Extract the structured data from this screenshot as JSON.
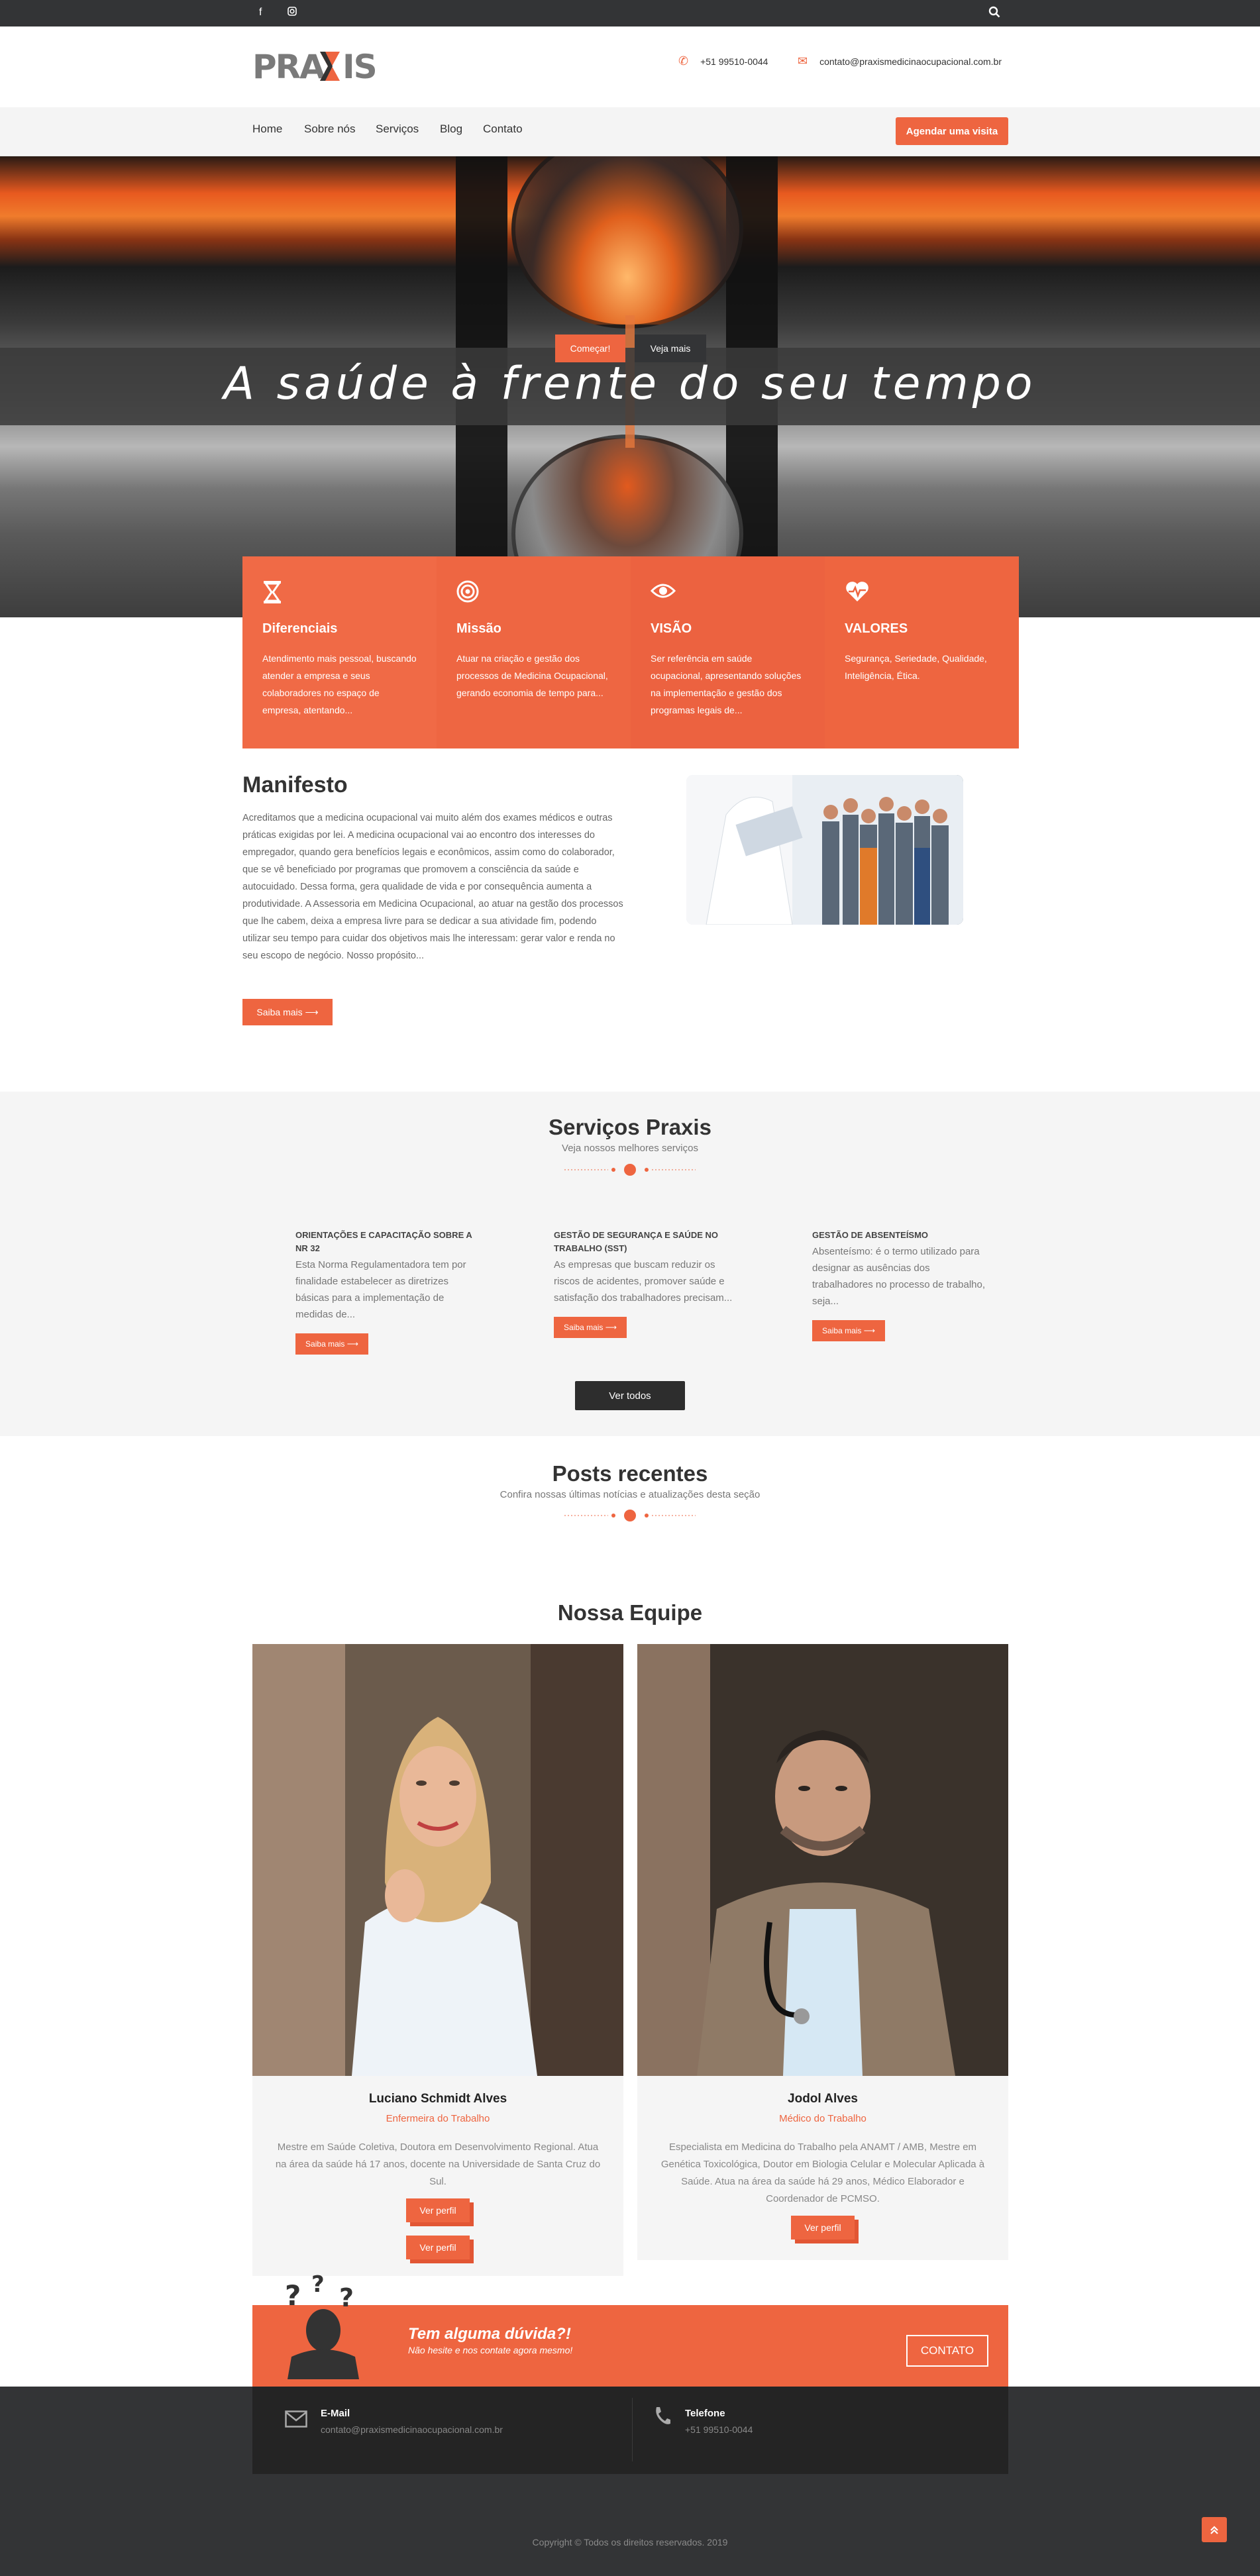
{
  "topbar": {
    "facebook_icon": "facebook-icon",
    "instagram_icon": "instagram-icon",
    "search_icon": "search-icon"
  },
  "header": {
    "logo_text": "PRAXIS",
    "phone": "+51 99510-0044",
    "email": "contato@praxismedicinaocupacional.com.br"
  },
  "nav": {
    "items": [
      "Home",
      "Sobre nós",
      "Serviços",
      "Blog",
      "Contato"
    ],
    "cta": "Agendar uma visita"
  },
  "hero": {
    "title": "A saúde à frente do seu tempo",
    "btn_start": "Começar!",
    "btn_more": "Veja mais"
  },
  "features": [
    {
      "icon": "hourglass-icon",
      "title": "Diferenciais",
      "text": "Atendimento mais pessoal, buscando atender a empresa e seus colaboradores no espaço de empresa, atentando..."
    },
    {
      "icon": "target-icon",
      "title": "Missão",
      "text": "Atuar na criação e gestão dos processos de Medicina Ocupacional, gerando economia de tempo para..."
    },
    {
      "icon": "eye-icon",
      "title": "VISÃO",
      "text": "Ser referência em saúde ocupacional, apresentando soluções na implementação e gestão dos programas legais de..."
    },
    {
      "icon": "heartbeat-icon",
      "title": "VALORES",
      "text": "Segurança, Seriedade, Qualidade, Inteligência, Ética."
    }
  ],
  "manifesto": {
    "title": "Manifesto",
    "text": "Acreditamos que a medicina ocupacional vai muito além dos exames médicos e outras práticas exigidas por lei. A medicina ocupacional vai ao encontro dos interesses do empregador, quando gera benefícios legais e econômicos, assim como do colaborador, que se vê beneficiado por programas que promovem a consciência da saúde e autocuidado. Dessa forma, gera qualidade de vida e por consequência aumenta a produtividade. A Assessoria em Medicina Ocupacional, ao atuar na gestão dos processos que lhe cabem, deixa a empresa livre para se dedicar a sua atividade fim, podendo utilizar seu tempo para cuidar dos objetivos mais lhe interessam: gerar valor e renda no seu escopo de negócio. Nosso propósito...",
    "button": "Saiba mais ⟶"
  },
  "services": {
    "title": "Serviços Praxis",
    "subtitle": "Veja nossos melhores serviços",
    "items": [
      {
        "title": "ORIENTAÇÕES E CAPACITAÇÃO SOBRE A NR 32",
        "text": "Esta Norma Regulamentadora tem por finalidade estabelecer as diretrizes básicas para a implementação de medidas de...",
        "button": "Saiba mais ⟶"
      },
      {
        "title": "GESTÃO DE SEGURANÇA E SAÚDE NO TRABALHO (SST)",
        "text": "As empresas que buscam reduzir os riscos de acidentes, promover saúde e satisfação dos trabalhadores precisam...",
        "button": "Saiba mais ⟶"
      },
      {
        "title": "GESTÃO DE ABSENTEÍSMO",
        "text": "Absenteísmo: é o termo utilizado para designar as ausências dos trabalhadores no processo de trabalho, seja...",
        "button": "Saiba mais ⟶"
      }
    ],
    "all_button": "Ver todos"
  },
  "posts": {
    "title": "Posts recentes",
    "subtitle": "Confira nossas últimas notícias e atualizações desta seção"
  },
  "team": {
    "title": "Nossa Equipe",
    "members": [
      {
        "name": "Luciano Schmidt Alves",
        "role": "Enfermeira do Trabalho",
        "bio": "Mestre em Saúde Coletiva, Doutora em Desenvolvimento Regional. Atua na área da saúde há 17 anos, docente na Universidade de Santa Cruz do Sul.",
        "button": "Ver perfil"
      },
      {
        "name": "Jodol Alves",
        "role": "Médico do Trabalho",
        "bio": "Especialista em Medicina do Trabalho pela ANAMT / AMB, Mestre em Genética Toxicológica, Doutor em Biologia Celular e Molecular Aplicada à Saúde. Atua na área da saúde há 29 anos, Médico Elaborador e Coordenador de PCMSO.",
        "button": "Ver perfil"
      }
    ]
  },
  "doubt": {
    "title": "Tem alguma dúvida?!",
    "subtitle": "Não hesite e nos contate agora mesmo!",
    "button": "CONTATO"
  },
  "footer": {
    "email_label": "E-Mail",
    "email_value": "contato@praxismedicinaocupacional.com.br",
    "phone_label": "Telefone",
    "phone_value": "+51 99510-0044",
    "copyright": "Copyright © Todos os direitos reservados. 2019"
  },
  "colors": {
    "accent": "#ee6540",
    "dark": "#333436"
  }
}
